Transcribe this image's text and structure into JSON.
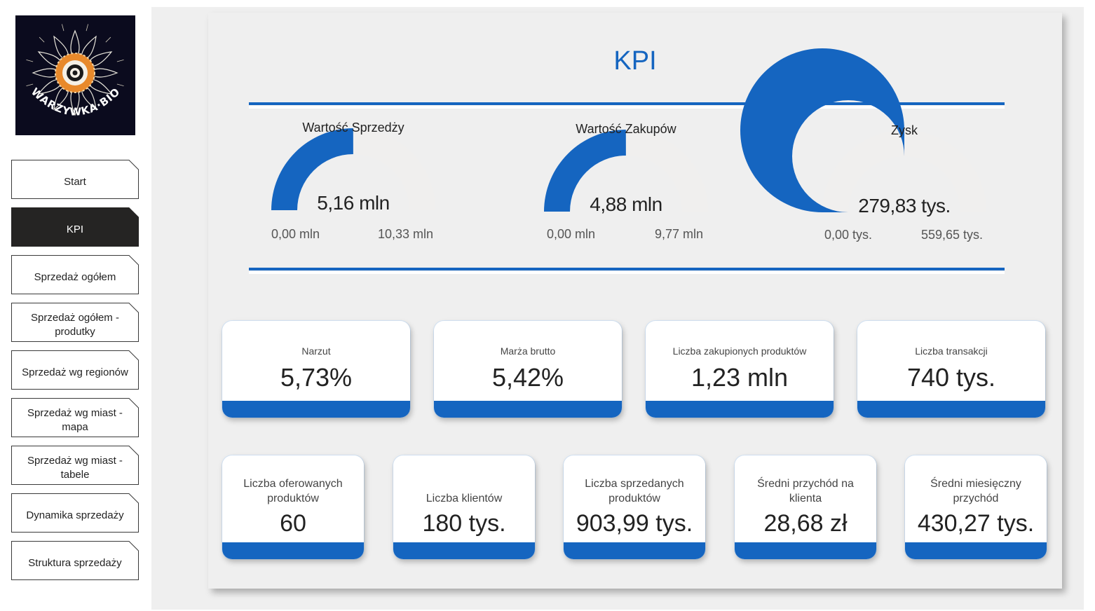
{
  "logo": {
    "text": "WARZYWKA·BIO"
  },
  "nav": [
    {
      "label": "Start",
      "active": false
    },
    {
      "label": "KPI",
      "active": true
    },
    {
      "label": "Sprzedaż ogółem",
      "active": false
    },
    {
      "label": "Sprzedaż ogółem - produtky",
      "active": false
    },
    {
      "label": "Sprzedaż wg regionów",
      "active": false
    },
    {
      "label": "Sprzedaż wg miast - mapa",
      "active": false
    },
    {
      "label": "Sprzedaż wg miast - tabele",
      "active": false
    },
    {
      "label": "Dynamika sprzedaży",
      "active": false
    },
    {
      "label": "Struktura sprzedaży",
      "active": false
    }
  ],
  "page": {
    "title": "KPI"
  },
  "colors": {
    "accent": "#1565c0",
    "gauge_track": "#f0efee",
    "active_nav": "#252423"
  },
  "gauges": [
    {
      "title": "Wartość Sprzedży",
      "value_label": "5,16 mln",
      "min_label": "0,00 mln",
      "max_label": "10,33 mln",
      "value": 5.16,
      "min": 0,
      "max": 10.33
    },
    {
      "title": "Wartość Zakupów",
      "value_label": "4,88 mln",
      "min_label": "0,00 mln",
      "max_label": "9,77 mln",
      "value": 4.88,
      "min": 0,
      "max": 9.77
    },
    {
      "title": "Zysk",
      "value_label": "279,83 tys.",
      "min_label": "0,00 tys.",
      "max_label": "559,65 tys.",
      "value": 279.83,
      "min": 0,
      "max": 559.65
    }
  ],
  "cards_row1": [
    {
      "label": "Narzut",
      "value": "5,73%"
    },
    {
      "label": "Marża brutto",
      "value": "5,42%"
    },
    {
      "label": "Liczba zakupionych produktów",
      "value": "1,23 mln"
    },
    {
      "label": "Liczba transakcji",
      "value": "740 tys."
    }
  ],
  "cards_row2": [
    {
      "label": "Liczba oferowanych produktów",
      "value": "60"
    },
    {
      "label": "Liczba klientów",
      "value": "180 tys."
    },
    {
      "label": "Liczba sprzedanych produktów",
      "value": "903,99 tys."
    },
    {
      "label": "Średni przychód na klienta",
      "value": "28,68 zł"
    },
    {
      "label": "Średni miesięczny przychód",
      "value": "430,27 tys."
    }
  ]
}
